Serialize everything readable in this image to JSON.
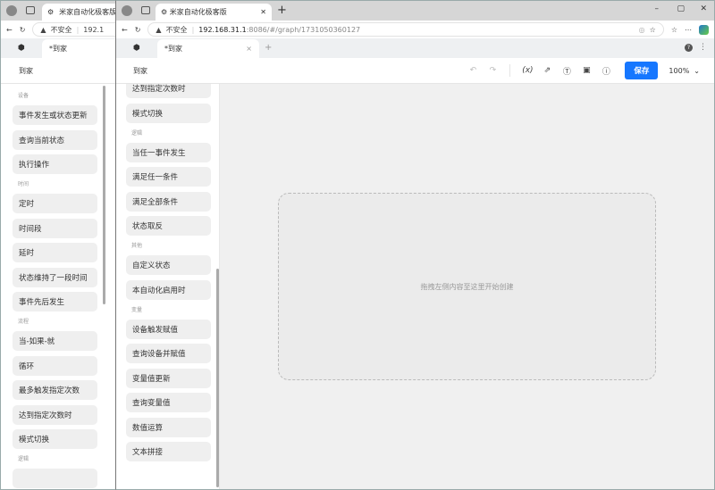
{
  "browser": {
    "tab_title": "米家自动化极客版",
    "insecure_label": "不安全",
    "url_host": "192.168.31.1",
    "url_rest": ":8086/#/graph/1731050360127",
    "url_host_truncated": "192.1",
    "new_tab": "+"
  },
  "app": {
    "tab_title": "*到家",
    "tab_close": "×",
    "tab_add": "+",
    "page_name": "到家"
  },
  "toolbar": {
    "variables": "(x)",
    "save_label": "保存",
    "zoom": "100%"
  },
  "canvas": {
    "placeholder": "拖拽左侧内容至这里开始创建"
  },
  "back_sidebar": [
    {
      "label": "设备",
      "items": [
        "事件发生或状态更新",
        "查询当前状态",
        "执行操作"
      ]
    },
    {
      "label": "时间",
      "items": [
        "定时",
        "时间段",
        "延时",
        "状态维持了一段时间",
        "事件先后发生"
      ]
    },
    {
      "label": "流程",
      "items": [
        "当-如果-就",
        "循环",
        "最多触发指定次数",
        "达到指定次数时",
        "模式切换"
      ]
    },
    {
      "label": "逻辑",
      "items": [
        ""
      ]
    }
  ],
  "front_sidebar": [
    {
      "label": "",
      "items": [
        "达到指定次数时",
        "模式切换"
      ]
    },
    {
      "label": "逻辑",
      "items": [
        "当任一事件发生",
        "满足任一条件",
        "满足全部条件",
        "状态取反"
      ]
    },
    {
      "label": "其他",
      "items": [
        "自定义状态",
        "本自动化启用时"
      ]
    },
    {
      "label": "变量",
      "items": [
        "设备触发赋值",
        "查询设备并赋值",
        "变量值更新",
        "查询变量值",
        "数值运算",
        "文本拼接"
      ]
    }
  ]
}
